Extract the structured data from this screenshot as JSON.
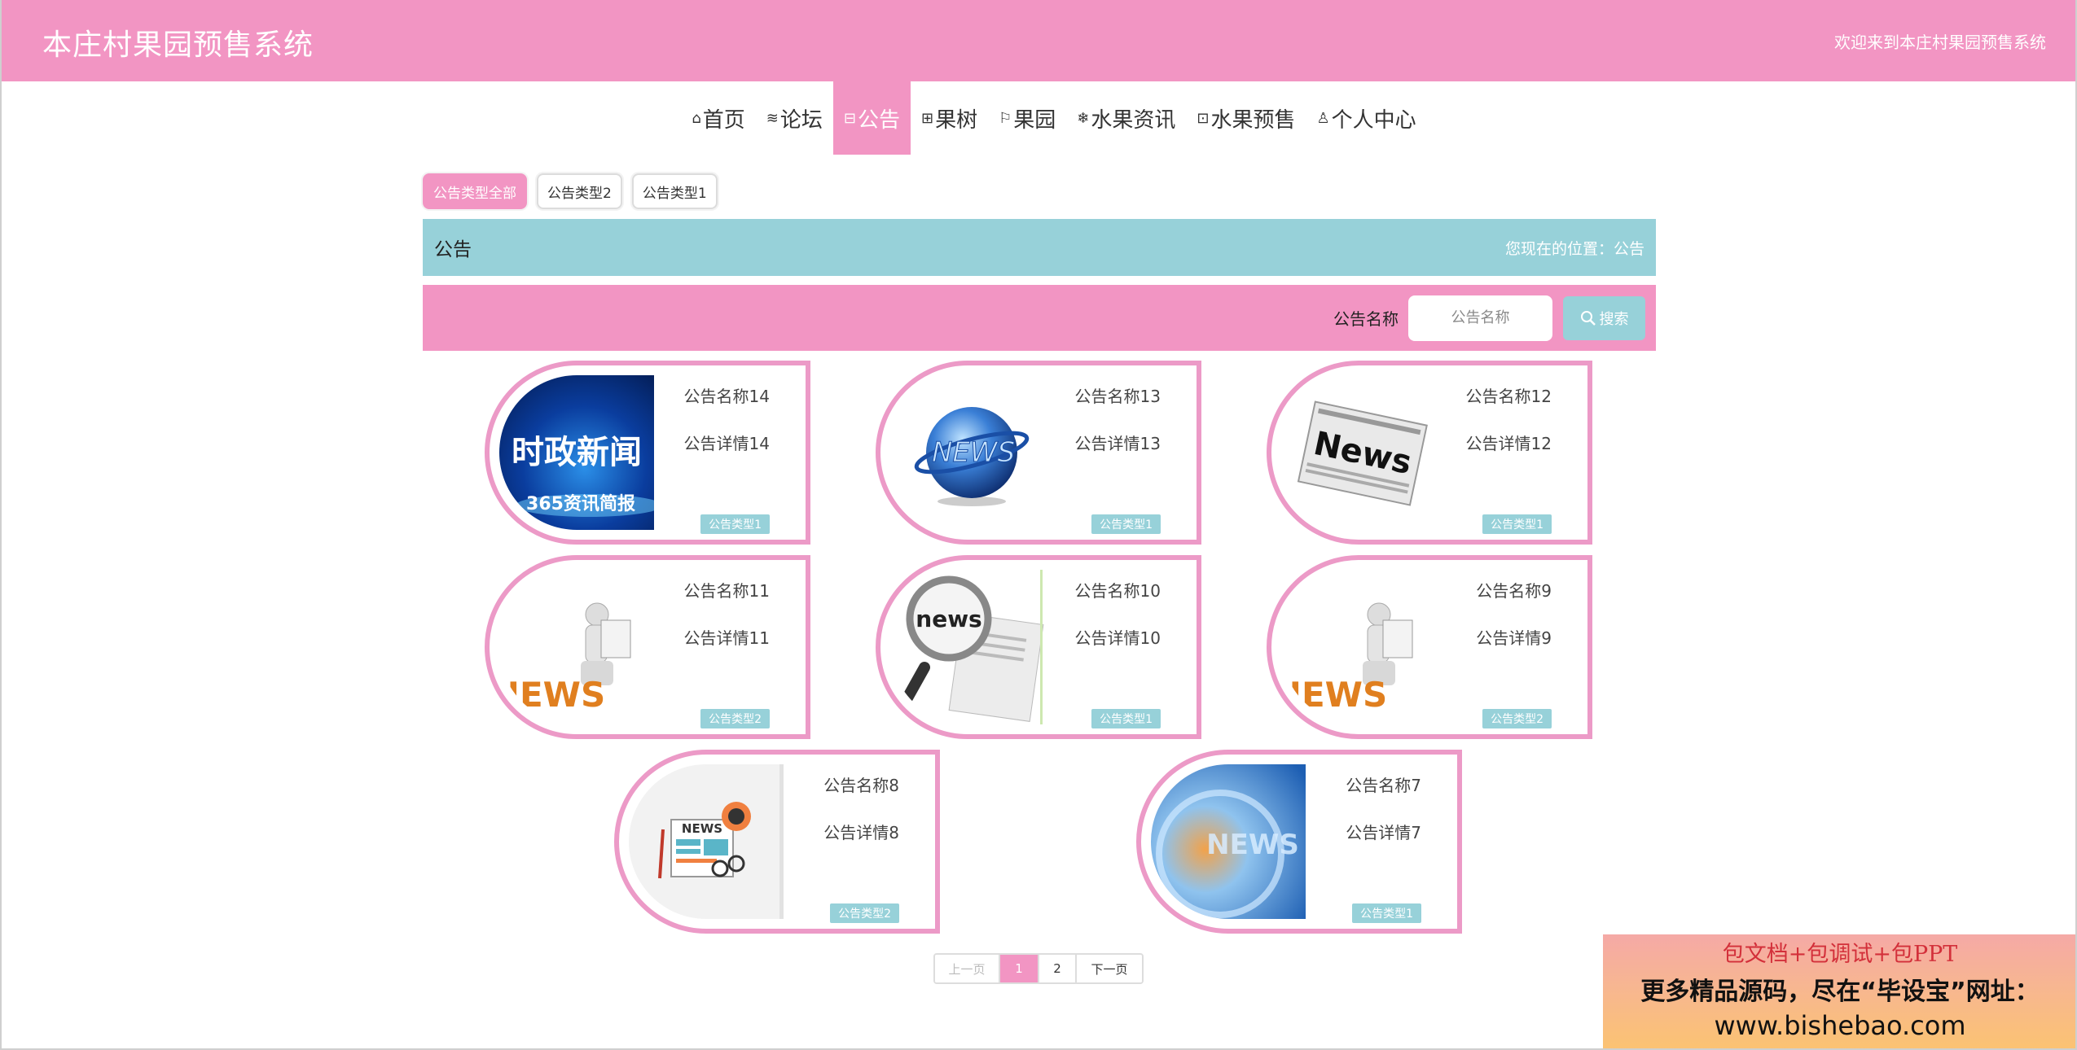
{
  "header": {
    "site_title": "本庄村果园预售系统",
    "welcome": "欢迎来到本庄村果园预售系统"
  },
  "nav": [
    {
      "icon": "home-icon",
      "label": "首页"
    },
    {
      "icon": "layers-icon",
      "label": "论坛"
    },
    {
      "icon": "gift-icon",
      "label": "公告"
    },
    {
      "icon": "grid-icon",
      "label": "果树"
    },
    {
      "icon": "flag-icon",
      "label": "果园"
    },
    {
      "icon": "snowflake-icon",
      "label": "水果资讯"
    },
    {
      "icon": "apps-icon",
      "label": "水果预售"
    },
    {
      "icon": "user-icon",
      "label": "个人中心"
    }
  ],
  "nav_active": "公告",
  "types": [
    "公告类型全部",
    "公告类型2",
    "公告类型1"
  ],
  "title_bar": {
    "title": "公告",
    "position": "您现在的位置：公告"
  },
  "search": {
    "label": "公告名称",
    "placeholder": "公告名称",
    "button": "搜索"
  },
  "cards": [
    {
      "name": "公告名称14",
      "detail": "公告详情14",
      "type": "公告类型1",
      "image": "shizheng-news",
      "image_text": [
        "时政新闻",
        "365资讯简报"
      ]
    },
    {
      "name": "公告名称13",
      "detail": "公告详情13",
      "type": "公告类型1",
      "image": "news-globe",
      "image_text": [
        "NEWS"
      ]
    },
    {
      "name": "公告名称12",
      "detail": "公告详情12",
      "type": "公告类型1",
      "image": "newspaper",
      "image_text": [
        "News"
      ]
    },
    {
      "name": "公告名称11",
      "detail": "公告详情11",
      "type": "公告类型2",
      "image": "news-figure",
      "image_text": [
        "NEWS"
      ]
    },
    {
      "name": "公告名称10",
      "detail": "公告详情10",
      "type": "公告类型1",
      "image": "magnifier-news",
      "image_text": [
        "news"
      ]
    },
    {
      "name": "公告名称9",
      "detail": "公告详情9",
      "type": "公告类型2",
      "image": "news-figure",
      "image_text": [
        "NEWS"
      ]
    },
    {
      "name": "公告名称8",
      "detail": "公告详情8",
      "type": "公告类型2",
      "image": "news-flat",
      "image_text": [
        "NEWS"
      ]
    },
    {
      "name": "公告名称7",
      "detail": "公告详情7",
      "type": "公告类型1",
      "image": "news-blue",
      "image_text": [
        "NEWS"
      ]
    }
  ],
  "pagination": {
    "prev": "上一页",
    "pages": [
      "1",
      "2"
    ],
    "current": "1",
    "next": "下一页"
  },
  "promo": {
    "line1": "包文档+包调试+包PPT",
    "line2": "更多精品源码，尽在“毕设宝”网址：",
    "line3": "www.bishebao.com"
  },
  "colors": {
    "pink": "#f295c3",
    "teal": "#97d1d9",
    "card_border": "#ec9ac7"
  }
}
